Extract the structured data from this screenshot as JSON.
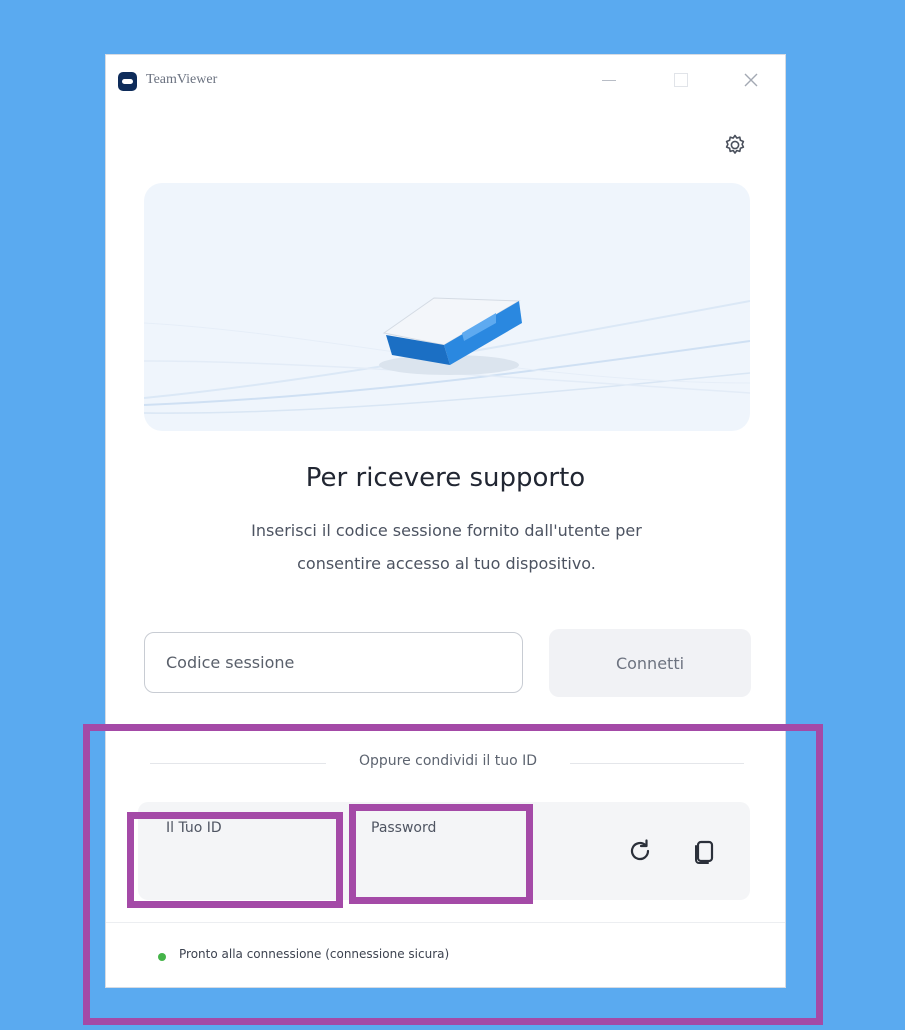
{
  "window": {
    "title": "TeamViewer",
    "controls": {
      "minimize": "—",
      "maximize": "□",
      "close": "✕"
    }
  },
  "settings": {
    "icon": "gear-icon"
  },
  "hero": {
    "illustration": "laptop-illustration"
  },
  "main": {
    "heading": "Per ricevere supporto",
    "subtext_line1": "Inserisci il codice sessione fornito dall'utente per",
    "subtext_line2": "consentire accesso al tuo dispositivo.",
    "session_input": {
      "placeholder": "Codice sessione",
      "value": ""
    },
    "connect_label": "Connetti"
  },
  "share": {
    "divider_label": "Oppure condividi il tuo ID",
    "id_label": "Il Tuo ID",
    "id_value": "",
    "password_label": "Password",
    "password_value": "",
    "refresh_icon": "refresh-icon",
    "copy_icon": "copy-icon"
  },
  "status": {
    "text": "Pronto alla connessione (connessione sicura)",
    "color": "#45b449"
  },
  "colors": {
    "background": "#5aaaf0",
    "highlight": "#a44aa7",
    "brand": "#0e2c5a",
    "accent": "#1f7ddc"
  }
}
